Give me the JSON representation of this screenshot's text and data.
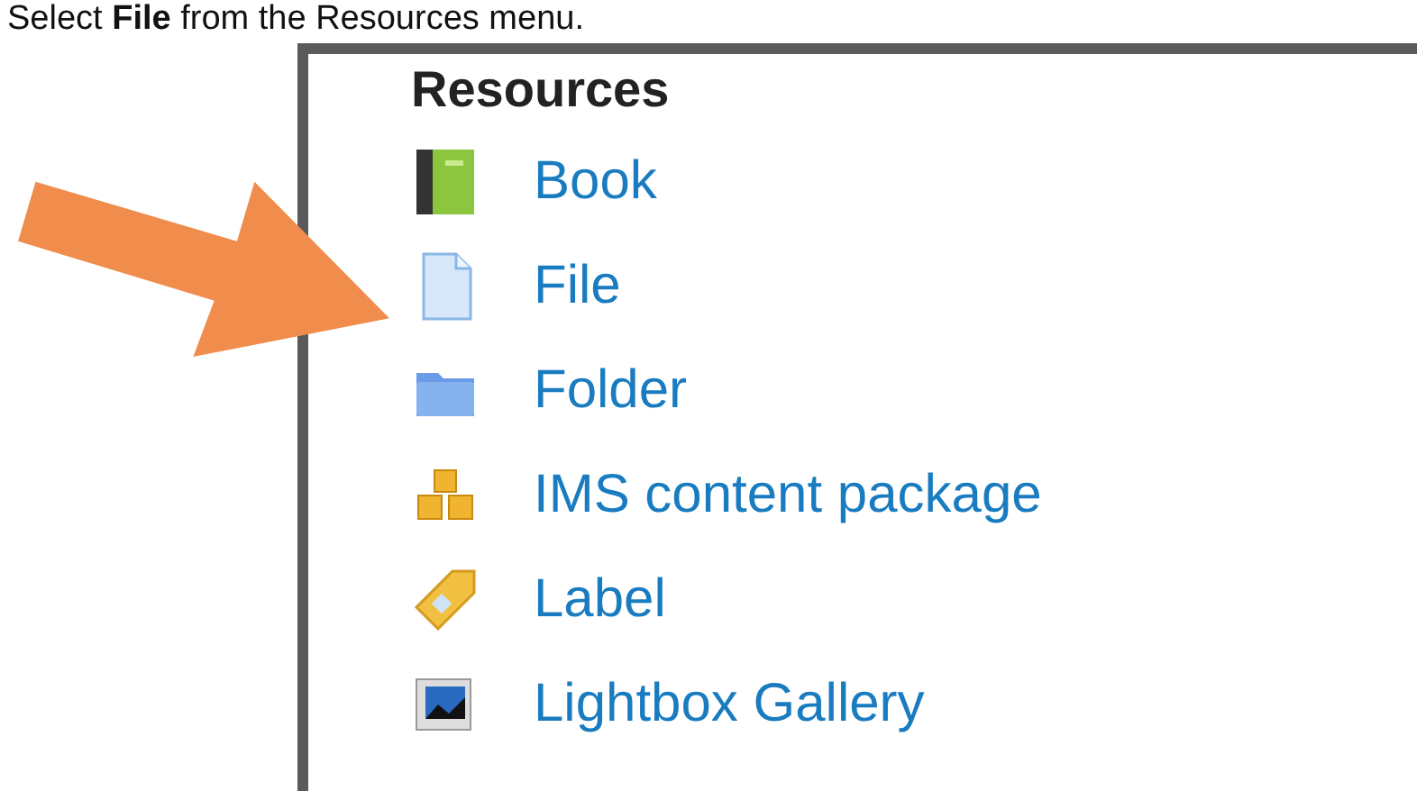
{
  "caption": "Select **File** from the Resources menu.",
  "panel": {
    "heading": "Resources",
    "items": [
      {
        "label": "Book",
        "kind": "book"
      },
      {
        "label": "File",
        "kind": "file"
      },
      {
        "label": "Folder",
        "kind": "folder"
      },
      {
        "label": "IMS content package",
        "kind": "package"
      },
      {
        "label": "Label",
        "kind": "label"
      },
      {
        "label": "Lightbox Gallery",
        "kind": "gallery"
      }
    ]
  }
}
